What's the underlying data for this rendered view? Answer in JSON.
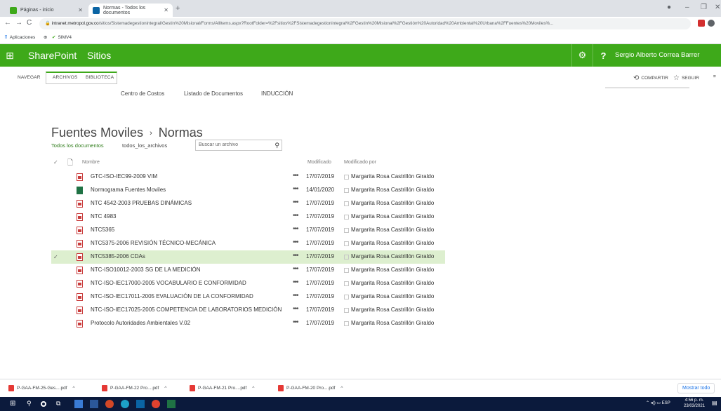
{
  "browser": {
    "tabs": [
      {
        "label": "Páginas - inicio",
        "active": false
      },
      {
        "label": "Normas - Todos los documentos",
        "active": true
      }
    ],
    "new_tab": "+",
    "url_host": "intranet.metropol.gov.co",
    "url_path": "/sitios/Sistemadegestionintegral/Gestin%20Misional/Forms/AllItems.aspx?RootFolder=%2Fsitios%2FSistemadegestionintegral%2FGestin%20Misional%2FGestión%20Autoridad%20Ambiental%20Urbana%2FFuentes%20Moviles%...",
    "bookmarks": [
      "Aplicaciones",
      "SIMV4"
    ]
  },
  "suite": {
    "brand": "SharePoint",
    "section": "Sitios",
    "gear": "⚙",
    "help": "?",
    "user": "Sergio Alberto Correa Barrer"
  },
  "ribbon": {
    "tabs": [
      "NAVEGAR",
      "ARCHIVOS",
      "BIBLIOTECA"
    ],
    "share": "COMPARTIR",
    "follow": "SEGUIR"
  },
  "topnav": [
    "Centro de Costos",
    "Listado de Documentos",
    "INDUCCIÓN"
  ],
  "page": {
    "title_parent": "Fuentes Moviles",
    "title_sep": "›",
    "title_current": "Normas",
    "views": [
      "Todos los documentos",
      "todos_los_archivos"
    ],
    "search_placeholder": "Buscar un archivo"
  },
  "list": {
    "headers": {
      "name": "Nombre",
      "modified": "Modificado",
      "modified_by": "Modificado por"
    },
    "rows": [
      {
        "name": "GTC-ISO-IEC99-2009 VIM",
        "type": "pdf",
        "date": "17/07/2019",
        "by": "Margarita Rosa Castrillón Giraldo",
        "selected": false
      },
      {
        "name": "Normograma Fuentes Moviles",
        "type": "xls",
        "date": "14/01/2020",
        "by": "Margarita Rosa Castrillón Giraldo",
        "selected": false
      },
      {
        "name": "NTC 4542-2003 PRUEBAS DINÁMICAS",
        "type": "pdf",
        "date": "17/07/2019",
        "by": "Margarita Rosa Castrillón Giraldo",
        "selected": false
      },
      {
        "name": "NTC 4983",
        "type": "pdf",
        "date": "17/07/2019",
        "by": "Margarita Rosa Castrillón Giraldo",
        "selected": false
      },
      {
        "name": "NTC5365",
        "type": "pdf",
        "date": "17/07/2019",
        "by": "Margarita Rosa Castrillón Giraldo",
        "selected": false
      },
      {
        "name": "NTC5375-2006 REVISIÓN TÉCNICO-MECÁNICA",
        "type": "pdf",
        "date": "17/07/2019",
        "by": "Margarita Rosa Castrillón Giraldo",
        "selected": false
      },
      {
        "name": "NTC5385-2006 CDAs",
        "type": "pdf",
        "date": "17/07/2019",
        "by": "Margarita Rosa Castrillón Giraldo",
        "selected": true
      },
      {
        "name": "NTC-ISO10012-2003 SG DE LA MEDICIÓN",
        "type": "pdf",
        "date": "17/07/2019",
        "by": "Margarita Rosa Castrillón Giraldo",
        "selected": false
      },
      {
        "name": "NTC-ISO-IEC17000-2005 VOCABULARIO E CONFORMIDAD",
        "type": "pdf",
        "date": "17/07/2019",
        "by": "Margarita Rosa Castrillón Giraldo",
        "selected": false
      },
      {
        "name": "NTC-ISO-IEC17011-2005 EVALUACIÓN DE LA CONFORMIDAD",
        "type": "pdf",
        "date": "17/07/2019",
        "by": "Margarita Rosa Castrillón Giraldo",
        "selected": false
      },
      {
        "name": "NTC-ISO-IEC17025-2005 COMPETENCIA DE LABORATORIOS MEDICIÓN",
        "type": "pdf",
        "date": "17/07/2019",
        "by": "Margarita Rosa Castrillón Giraldo",
        "selected": false
      },
      {
        "name": "Protocolo Autoridades Ambientales V.02",
        "type": "pdf",
        "date": "17/07/2019",
        "by": "Margarita Rosa Castrillón Giraldo",
        "selected": false
      }
    ]
  },
  "downloads": {
    "items": [
      "P-GAA-FM-25-Ges....pdf",
      "P-GAA-FM-22 Pro....pdf",
      "P-GAA-FM-21 Pro....pdf",
      "P-GAA-FM-20 Pro....pdf"
    ],
    "show_all": "Mostrar todo"
  },
  "taskbar": {
    "lang": "ESP",
    "time": "4:56 p. m.",
    "date": "23/03/2021"
  },
  "colors": {
    "suite_green": "#3ea91a",
    "selected_row": "#ddefcf",
    "link_green": "#2f7d1b"
  }
}
